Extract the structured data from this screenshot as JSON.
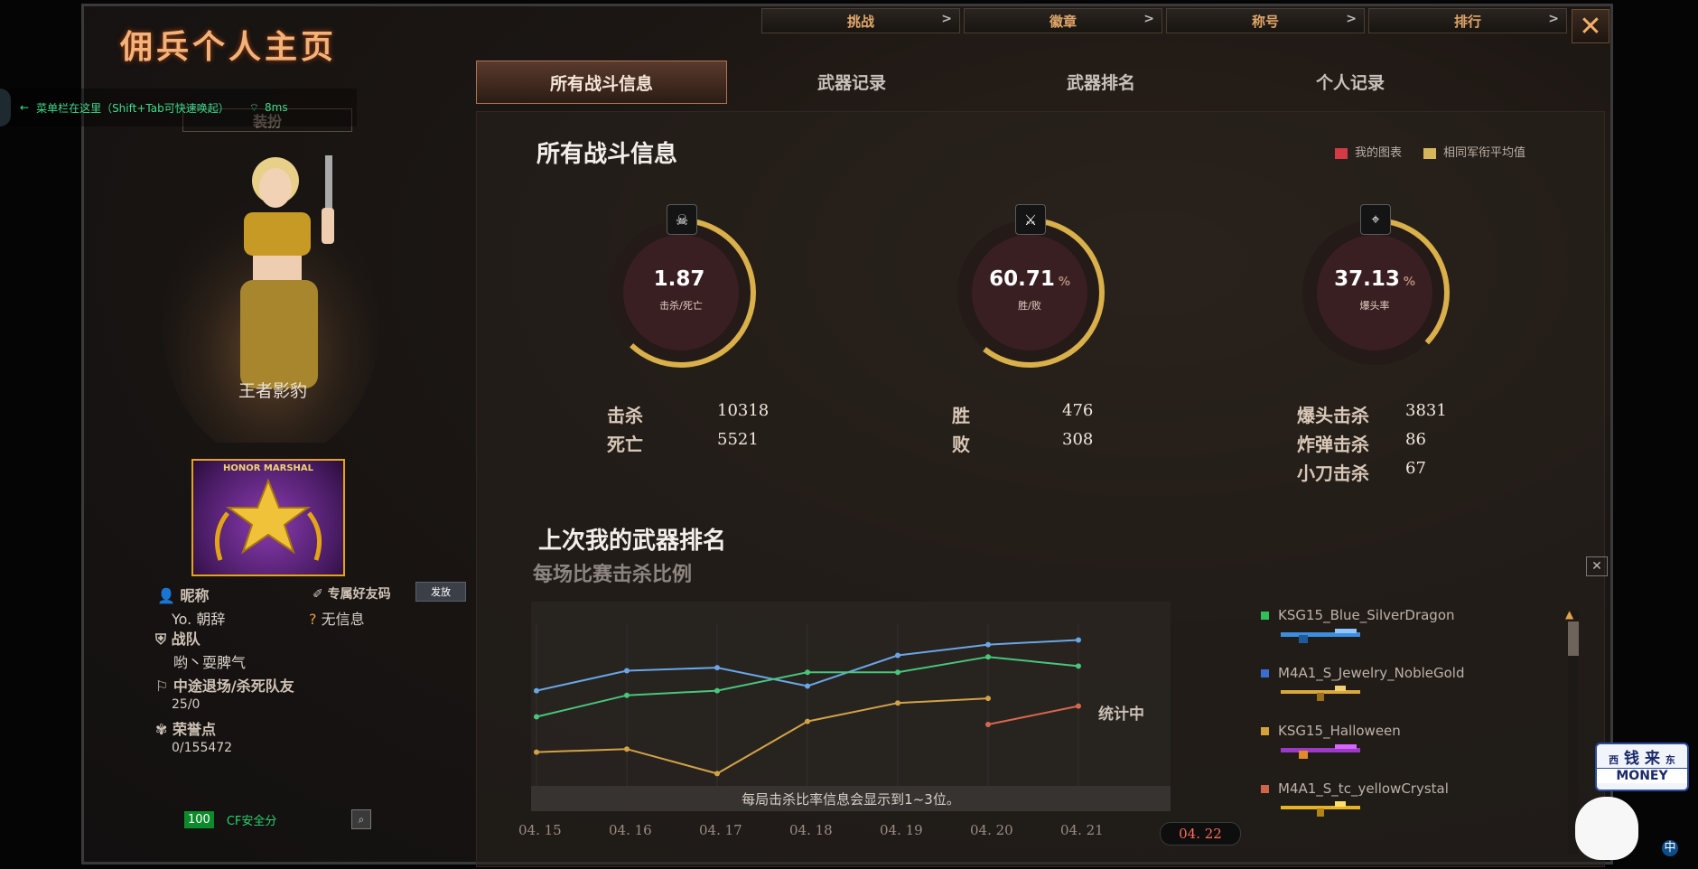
{
  "window": {
    "title": "佣兵个人主页",
    "close_label": "✕"
  },
  "top_buttons": [
    {
      "label": "挑战",
      "arrow": ">"
    },
    {
      "label": "徽章",
      "arrow": ">"
    },
    {
      "label": "称号",
      "arrow": ">"
    },
    {
      "label": "排行",
      "arrow": ">"
    }
  ],
  "tabs": [
    "所有战斗信息",
    "武器记录",
    "武器排名",
    "个人记录"
  ],
  "toast": {
    "text": "菜单栏在这里（Shift+Tab可快速唤起）",
    "latency": "8ms"
  },
  "left": {
    "equip_label": "装扮",
    "character_name": "王者影豹",
    "badge_label": "HONOR MARSHAL",
    "nickname_label": "昵称",
    "nickname_value": "Yo. 朝辞",
    "friend_code_label": "专属好友码",
    "send_label": "发放",
    "friend_code_value": "无信息",
    "team_label": "战队",
    "team_value": "哟丶耍脾气",
    "quit_label": "中途退场/杀死队友",
    "quit_value": "25/0",
    "honor_label": "荣誉点",
    "honor_value": "0/155472",
    "safety_score": "100",
    "safety_label": "CF安全分"
  },
  "combat": {
    "title": "所有战斗信息",
    "legend": [
      {
        "label": "我的图表",
        "color": "#d23a45"
      },
      {
        "label": "相同军衔平均值",
        "color": "#d6b65a"
      }
    ],
    "rings": [
      {
        "value": "1.87",
        "unit": "",
        "label": "击杀/死亡",
        "icon": "skull-icon",
        "glyph": "☠",
        "fill": 0.62
      },
      {
        "value": "60.71",
        "unit": "%",
        "label": "胜/败",
        "icon": "crossed-swords-icon",
        "glyph": "⚔",
        "fill": 0.6071
      },
      {
        "value": "37.13",
        "unit": "%",
        "label": "爆头率",
        "icon": "target-icon",
        "glyph": "⌖",
        "fill": 0.3713
      }
    ],
    "stats": {
      "kill_label": "击杀",
      "kill": "10318",
      "death_label": "死亡",
      "death": "5521",
      "win_label": "胜",
      "win": "476",
      "lose_label": "败",
      "lose": "308",
      "headshot_label": "爆头击杀",
      "headshot": "3831",
      "bomb_label": "炸弹击杀",
      "bomb": "86",
      "knife_label": "小刀击杀",
      "knife": "67"
    }
  },
  "ranking": {
    "title": "上次我的武器排名",
    "subtitle": "每场比赛击杀比例",
    "counting_label": "统计中",
    "note": "每局击杀比率信息会显示到1~3位。",
    "dates": [
      "04. 15",
      "04. 16",
      "04. 17",
      "04. 18",
      "04. 19",
      "04. 20",
      "04. 21",
      "04. 22"
    ],
    "weapons": [
      {
        "name": "KSG15_Blue_SilverDragon",
        "color": "#2fc05a",
        "gun": "blue"
      },
      {
        "name": "M4A1_S_Jewelry_NobleGold",
        "color": "#3b6dd0",
        "gun": "gold"
      },
      {
        "name": "KSG15_Halloween",
        "color": "#d5a23a",
        "gun": "purple"
      },
      {
        "name": "M4A1_S_tc_yellowCrystal",
        "color": "#d0644b",
        "gun": "yellow"
      }
    ]
  },
  "chart_data": {
    "type": "line",
    "x": [
      "04. 15",
      "04. 16",
      "04. 17",
      "04. 18",
      "04. 19",
      "04. 20",
      "04. 21",
      "04. 22"
    ],
    "ylim": [
      0,
      100
    ],
    "series": [
      {
        "name": "M4A1_S_Jewelry_NobleGold",
        "color": "#6aa6e6",
        "values": [
          62,
          75,
          77,
          65,
          85,
          92,
          95,
          null
        ]
      },
      {
        "name": "KSG15_Blue_SilverDragon",
        "color": "#48c67b",
        "values": [
          45,
          59,
          62,
          74,
          74,
          84,
          78,
          null
        ]
      },
      {
        "name": "KSG15_Halloween",
        "color": "#d2a247",
        "values": [
          22,
          24,
          8,
          42,
          54,
          57,
          null,
          null
        ]
      },
      {
        "name": "M4A1_S_tc_yellowCrystal",
        "color": "#d8664f",
        "values": [
          null,
          null,
          null,
          null,
          null,
          40,
          52,
          null
        ]
      }
    ]
  },
  "mascot": {
    "sign_top": "钱 来",
    "sign_left": "西",
    "sign_right": "东",
    "sign_bottom": "MONEY",
    "ime": "中"
  }
}
